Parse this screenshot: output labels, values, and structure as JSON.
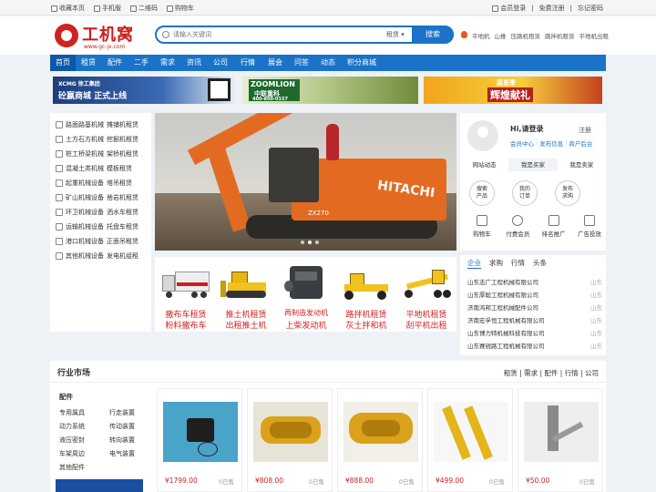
{
  "topbar": {
    "left": [
      "收藏本页",
      "手机版",
      "二维码",
      "购物车"
    ],
    "right": [
      "会员登录",
      "免费注册",
      "忘记密码"
    ]
  },
  "logo": {
    "title": "工机窝",
    "url": "www.gc-jx.com"
  },
  "search": {
    "placeholder": "请输入关键词",
    "selected": "租赁",
    "button": "搜索"
  },
  "hot_links": [
    "平地机",
    "山推",
    "压路机租赁",
    "路拌机租赁",
    "平地机出租"
  ],
  "nav": [
    "首页",
    "租赁",
    "配件",
    "二手",
    "需求",
    "资讯",
    "公司",
    "行情",
    "展会",
    "问答",
    "动态",
    "积分商城"
  ],
  "banners": {
    "b1_brand": "XCMG 徐工集团",
    "b1_slogan": "砼嬴商城 正式上线",
    "b2_brand": "ZOOMLION",
    "b2_sub": "中联重科",
    "b2_phone": "400-800-0157",
    "b3_top": "感恩季",
    "b3_main": "辉煌献礼"
  },
  "categories": [
    {
      "a": "路面路基机械",
      "b": "摊铺机租赁"
    },
    {
      "a": "土方石方机械",
      "b": "挖掘机租赁"
    },
    {
      "a": "桩工桥梁机械",
      "b": "架桥机租赁"
    },
    {
      "a": "混凝土类机械",
      "b": "模板租赁"
    },
    {
      "a": "起重机械设备",
      "b": "塔吊租赁"
    },
    {
      "a": "矿山机械设备",
      "b": "凿岩机租赁"
    },
    {
      "a": "环卫机械设备",
      "b": "洒水车租赁"
    },
    {
      "a": "运输机械设备",
      "b": "托盘车租赁"
    },
    {
      "a": "港口机械设备",
      "b": "正面吊租赁"
    },
    {
      "a": "其他机械设备",
      "b": "发电机组租"
    }
  ],
  "hero": {
    "brand": "HITACHI",
    "model": "ZX270"
  },
  "products": [
    {
      "l1": "撒布车租赁",
      "l2": "粉料撒布车"
    },
    {
      "l1": "推土机租赁",
      "l2": "出租推土机"
    },
    {
      "l1": "再制造发动机",
      "l2": "上柴发动机"
    },
    {
      "l1": "路拌机租赁",
      "l2": "灰土拌和机"
    },
    {
      "l1": "平地机租赁",
      "l2": "刮平机出租"
    }
  ],
  "user": {
    "greeting": "Hi,请登录",
    "register": "注册",
    "links": [
      "会员中心",
      "|",
      "发布信息",
      "|",
      "商户后台"
    ],
    "tabs": [
      "网站动态",
      "我是买家",
      "我是卖家"
    ],
    "circles": [
      "搜索\n产品",
      "我的\n订单",
      "发布\n求购"
    ],
    "icons": [
      "购物车",
      "付费会员",
      "排名推广",
      "广告投放"
    ]
  },
  "news": {
    "tabs": [
      "企业",
      "求购",
      "行情",
      "头条"
    ],
    "items": [
      {
        "name": "山东志广工程机械有限公司",
        "tag": "山东"
      },
      {
        "name": "山东厚聪工程机械有限公司",
        "tag": "山东"
      },
      {
        "name": "济南鸿邦工程机械配件公司",
        "tag": "山东"
      },
      {
        "name": "济南宏孚恒工程机械有限公司",
        "tag": "山东"
      },
      {
        "name": "山东博力特机械科技有限公司",
        "tag": "山东"
      },
      {
        "name": "山东赛锐路工程机械有限公司",
        "tag": "山东"
      }
    ]
  },
  "market": {
    "title": "行业市场",
    "links": "租赁 | 需求 | 配件 | 行情 | 公司",
    "side_title": "配件",
    "side_items": [
      "专用属具",
      "行走装置",
      "动力系统",
      "传动装置",
      "液压密封",
      "转向装置",
      "车架周边",
      "电气装置",
      "其他配件"
    ],
    "cards": [
      {
        "price": "¥1799.00",
        "sold": "0已售"
      },
      {
        "price": "¥808.00",
        "sold": "0已售"
      },
      {
        "price": "¥888.00",
        "sold": "0已售"
      },
      {
        "price": "¥499.00",
        "sold": "0已售"
      },
      {
        "price": "¥50.00",
        "sold": "0已售"
      }
    ]
  }
}
